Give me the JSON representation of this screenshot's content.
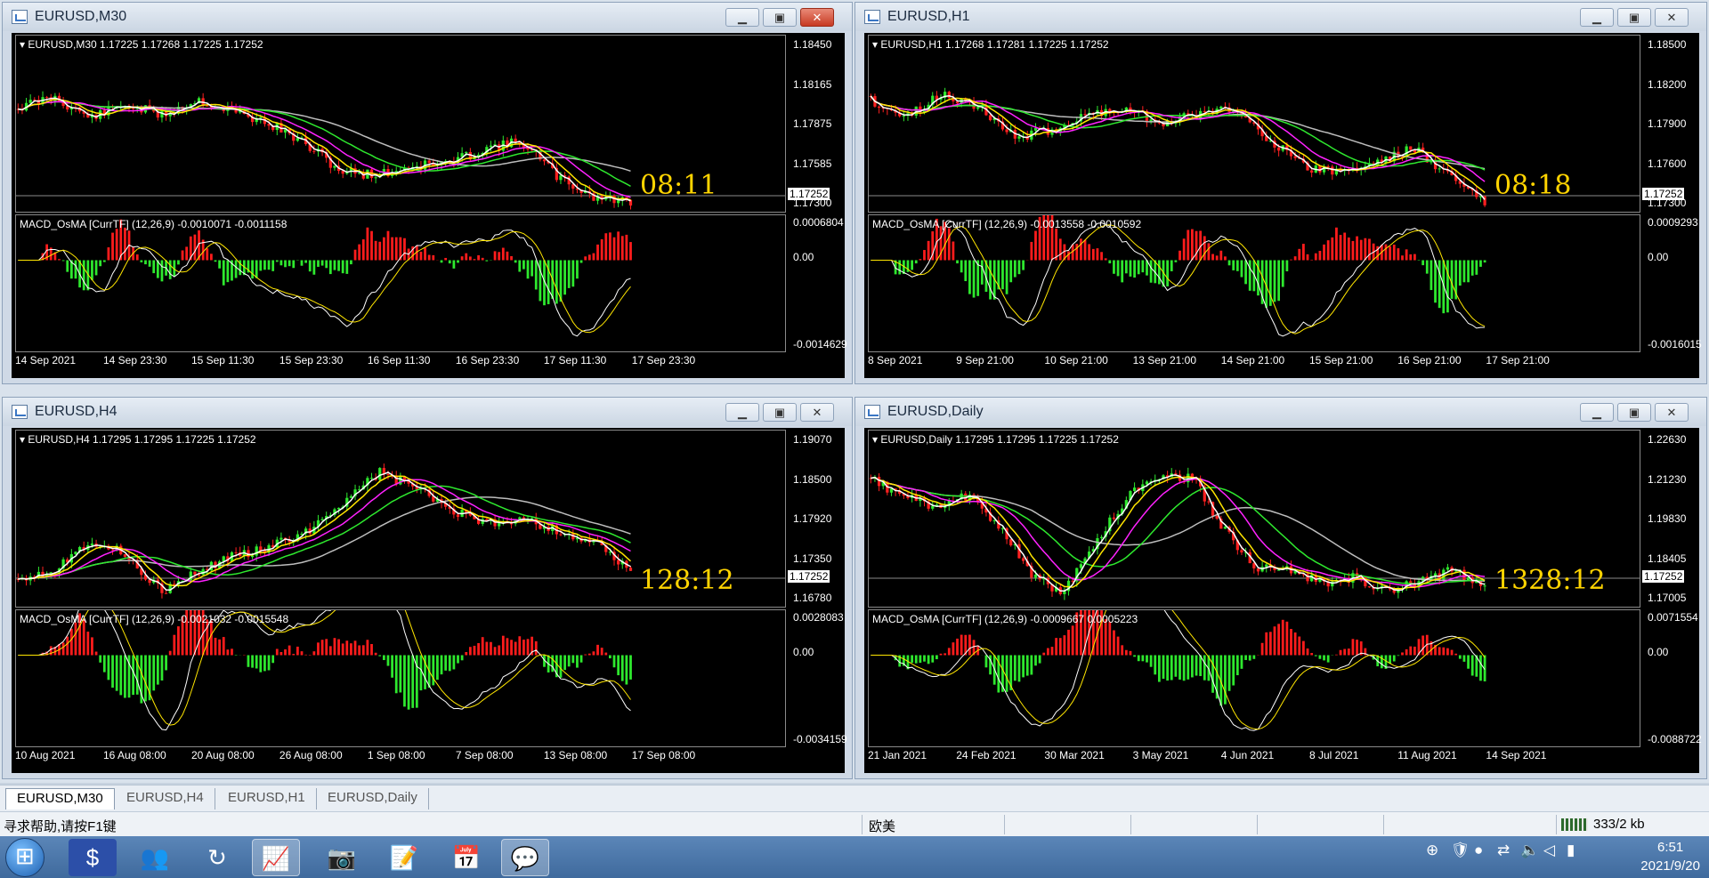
{
  "colors": {
    "ma_white": "#ffffff",
    "ma_yellow": "#ffe600",
    "ma_magenta": "#ff22ff",
    "ma_green": "#2ee82e",
    "ma_gray": "#bdbdbd",
    "candle_up": "#2ee82e",
    "candle_down": "#ff2020",
    "hist_up": "#ff1c1c",
    "hist_down": "#2ee82e",
    "timer": "#ffd400"
  },
  "windows": [
    {
      "id": "m30",
      "title": "EURUSD,M30",
      "close_active": true,
      "price_label": "EURUSD,M30  1.17225 1.17268 1.17225 1.17252",
      "price_ticks": [
        "1.18450",
        "1.18165",
        "1.17875",
        "1.17585",
        "1.17300"
      ],
      "current_price": "1.17252",
      "timer": "08:11",
      "macd_label": "MACD_OsMA [CurrTF] (12,26,9) -0.0010071 -0.0011158",
      "macd_ticks": [
        "0.0006804",
        "0.00",
        "-0.0014629"
      ],
      "time_ticks": [
        "14 Sep 2021",
        "14 Sep 23:30",
        "15 Sep 11:30",
        "15 Sep 23:30",
        "16 Sep 11:30",
        "16 Sep 23:30",
        "17 Sep 11:30",
        "17 Sep 23:30"
      ]
    },
    {
      "id": "h1",
      "title": "EURUSD,H1",
      "close_active": false,
      "price_label": "EURUSD,H1  1.17268 1.17281 1.17225 1.17252",
      "price_ticks": [
        "1.18500",
        "1.18200",
        "1.17900",
        "1.17600",
        "1.17300"
      ],
      "current_price": "1.17252",
      "timer": "08:18",
      "macd_label": "MACD_OsMA [CurrTF] (12,26,9) -0.0013558 -0.0010592",
      "macd_ticks": [
        "0.0009293",
        "0.00",
        "-0.0016015"
      ],
      "time_ticks": [
        "8 Sep 2021",
        "9 Sep 21:00",
        "10 Sep 21:00",
        "13 Sep 21:00",
        "14 Sep 21:00",
        "15 Sep 21:00",
        "16 Sep 21:00",
        "17 Sep 21:00"
      ]
    },
    {
      "id": "h4",
      "title": "EURUSD,H4",
      "close_active": false,
      "price_label": "EURUSD,H4  1.17295 1.17295 1.17225 1.17252",
      "price_ticks": [
        "1.19070",
        "1.18500",
        "1.17920",
        "1.17350",
        "1.16780"
      ],
      "current_price": "1.17252",
      "timer": "128:12",
      "macd_label": "MACD_OsMA [CurrTF] (12,26,9) -0.0021032 -0.0015548",
      "macd_ticks": [
        "0.0028083",
        "0.00",
        "-0.0034159"
      ],
      "time_ticks": [
        "10 Aug 2021",
        "16 Aug 08:00",
        "20 Aug 08:00",
        "26 Aug 08:00",
        "1 Sep 08:00",
        "7 Sep 08:00",
        "13 Sep 08:00",
        "17 Sep 08:00"
      ]
    },
    {
      "id": "daily",
      "title": "EURUSD,Daily",
      "close_active": false,
      "price_label": "EURUSD,Daily  1.17295 1.17295 1.17225 1.17252",
      "price_ticks": [
        "1.22630",
        "1.21230",
        "1.19830",
        "1.18405",
        "1.17005"
      ],
      "current_price": "1.17252",
      "timer": "1328:12",
      "macd_label": "MACD_OsMA [CurrTF] (12,26,9) -0.0009667 0.0005223",
      "macd_ticks": [
        "0.0071554",
        "0.00",
        "-0.0088722"
      ],
      "time_ticks": [
        "21 Jan 2021",
        "24 Feb 2021",
        "30 Mar 2021",
        "3 May 2021",
        "4 Jun 2021",
        "8 Jul 2021",
        "11 Aug 2021",
        "14 Sep 2021"
      ]
    }
  ],
  "tabs": [
    "EURUSD,M30",
    "EURUSD,H4",
    "EURUSD,H1",
    "EURUSD,Daily"
  ],
  "active_tab": 0,
  "status": {
    "help": "寻求帮助,请按F1键",
    "profile": "欧美",
    "traffic": "333/2 kb"
  },
  "taskbar": {
    "time": "6:51",
    "date": "2021/9/20"
  }
}
